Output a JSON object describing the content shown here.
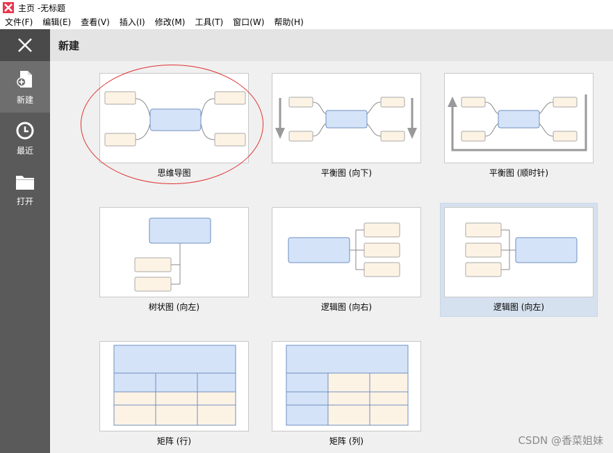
{
  "window": {
    "title": "主页 -无标题"
  },
  "menu": [
    "文件(F)",
    "编辑(E)",
    "查看(V)",
    "插入(I)",
    "修改(M)",
    "工具(T)",
    "窗口(W)",
    "帮助(H)"
  ],
  "sidebar": {
    "items": [
      {
        "label": "新建",
        "icon": "new-file-icon"
      },
      {
        "label": "最近",
        "icon": "clock-icon"
      },
      {
        "label": "打开",
        "icon": "folder-icon"
      }
    ]
  },
  "header": {
    "title": "新建"
  },
  "templates": [
    {
      "label": "思维导图"
    },
    {
      "label": "平衡图 (向下)"
    },
    {
      "label": "平衡图 (顺时针)"
    },
    {
      "label": "树状图 (向左)"
    },
    {
      "label": "逻辑图 (向右)"
    },
    {
      "label": "逻辑图 (向左)"
    },
    {
      "label": "矩阵 (行)"
    },
    {
      "label": "矩阵 (列)"
    }
  ],
  "watermark": "CSDN @香菜姐妹",
  "colors": {
    "topic_blue": "#d4e3f8",
    "sub_beige": "#fdf3e5",
    "sidebar": "#5a5a5a",
    "selected": "#d5e1ee",
    "annotation": "#e03030"
  }
}
